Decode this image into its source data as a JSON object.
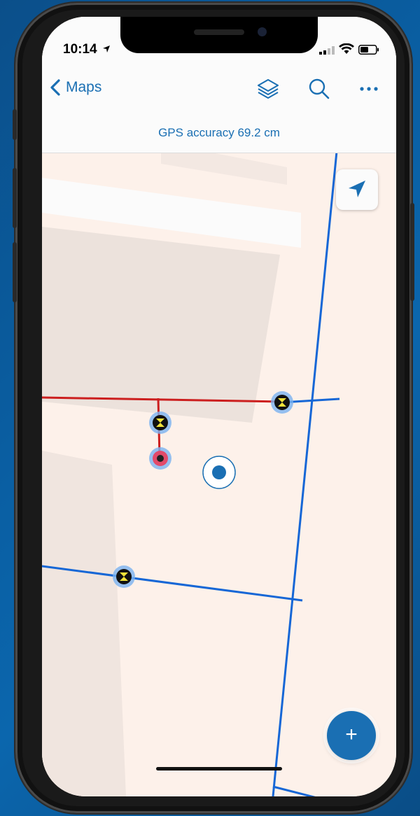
{
  "status_bar": {
    "time": "10:14",
    "location_icon": "location-arrow-icon",
    "signal_icon": "cellular-signal-icon",
    "wifi_icon": "wifi-icon",
    "battery_icon": "battery-icon"
  },
  "nav": {
    "back_label": "Maps",
    "icons": [
      "layers-icon",
      "search-icon",
      "more-icon"
    ]
  },
  "gps": {
    "accuracy_text": "GPS accuracy 69.2 cm"
  },
  "map": {
    "line_colors": {
      "water_main": "#1667d6",
      "service_line": "#cc1f1f"
    },
    "feature_symbols": [
      "valve-yellow",
      "meter-red"
    ]
  },
  "buttons": {
    "add_label": "+"
  },
  "colors": {
    "accent": "#1a6fb3",
    "map_background": "#fdf1ea",
    "building": "#ece2dc"
  }
}
